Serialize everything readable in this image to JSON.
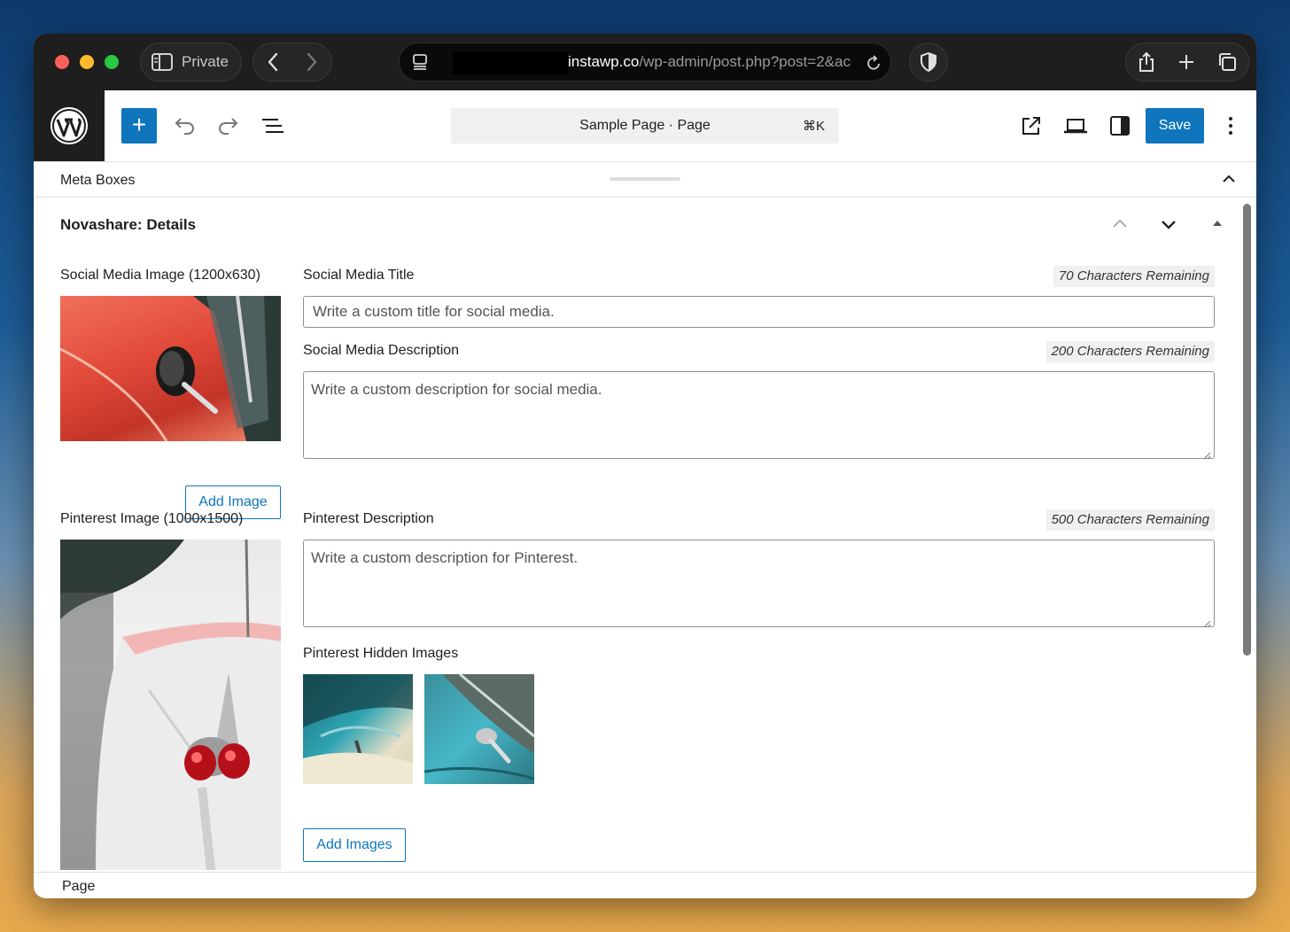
{
  "browser": {
    "private_label": "Private",
    "url_domain": "instawp.co",
    "url_path": "/wp-admin/post.php?post=2&ac"
  },
  "toolbar": {
    "command_title": "Sample Page · Page",
    "command_shortcut": "⌘K",
    "save_label": "Save"
  },
  "meta_boxes": {
    "label": "Meta Boxes"
  },
  "panel": {
    "title": "Novashare: Details",
    "social_image_label": "Social Media Image (1200x630)",
    "add_image_label": "Add Image",
    "social_title_label": "Social Media Title",
    "social_title_counter": "70 Characters Remaining",
    "social_title_placeholder": "Write a custom title for social media.",
    "social_desc_label": "Social Media Description",
    "social_desc_counter": "200 Characters Remaining",
    "social_desc_placeholder": "Write a custom description for social media.",
    "pinterest_image_label": "Pinterest Image (1000x1500)",
    "pinterest_desc_label": "Pinterest Description",
    "pinterest_desc_counter": "500 Characters Remaining",
    "pinterest_desc_placeholder": "Write a custom description for Pinterest.",
    "pinterest_hidden_label": "Pinterest Hidden Images",
    "add_images_label": "Add Images"
  },
  "footer": {
    "breadcrumb": "Page"
  },
  "colors": {
    "accent": "#0f75bd",
    "chrome_bg": "#1e1e1e"
  }
}
